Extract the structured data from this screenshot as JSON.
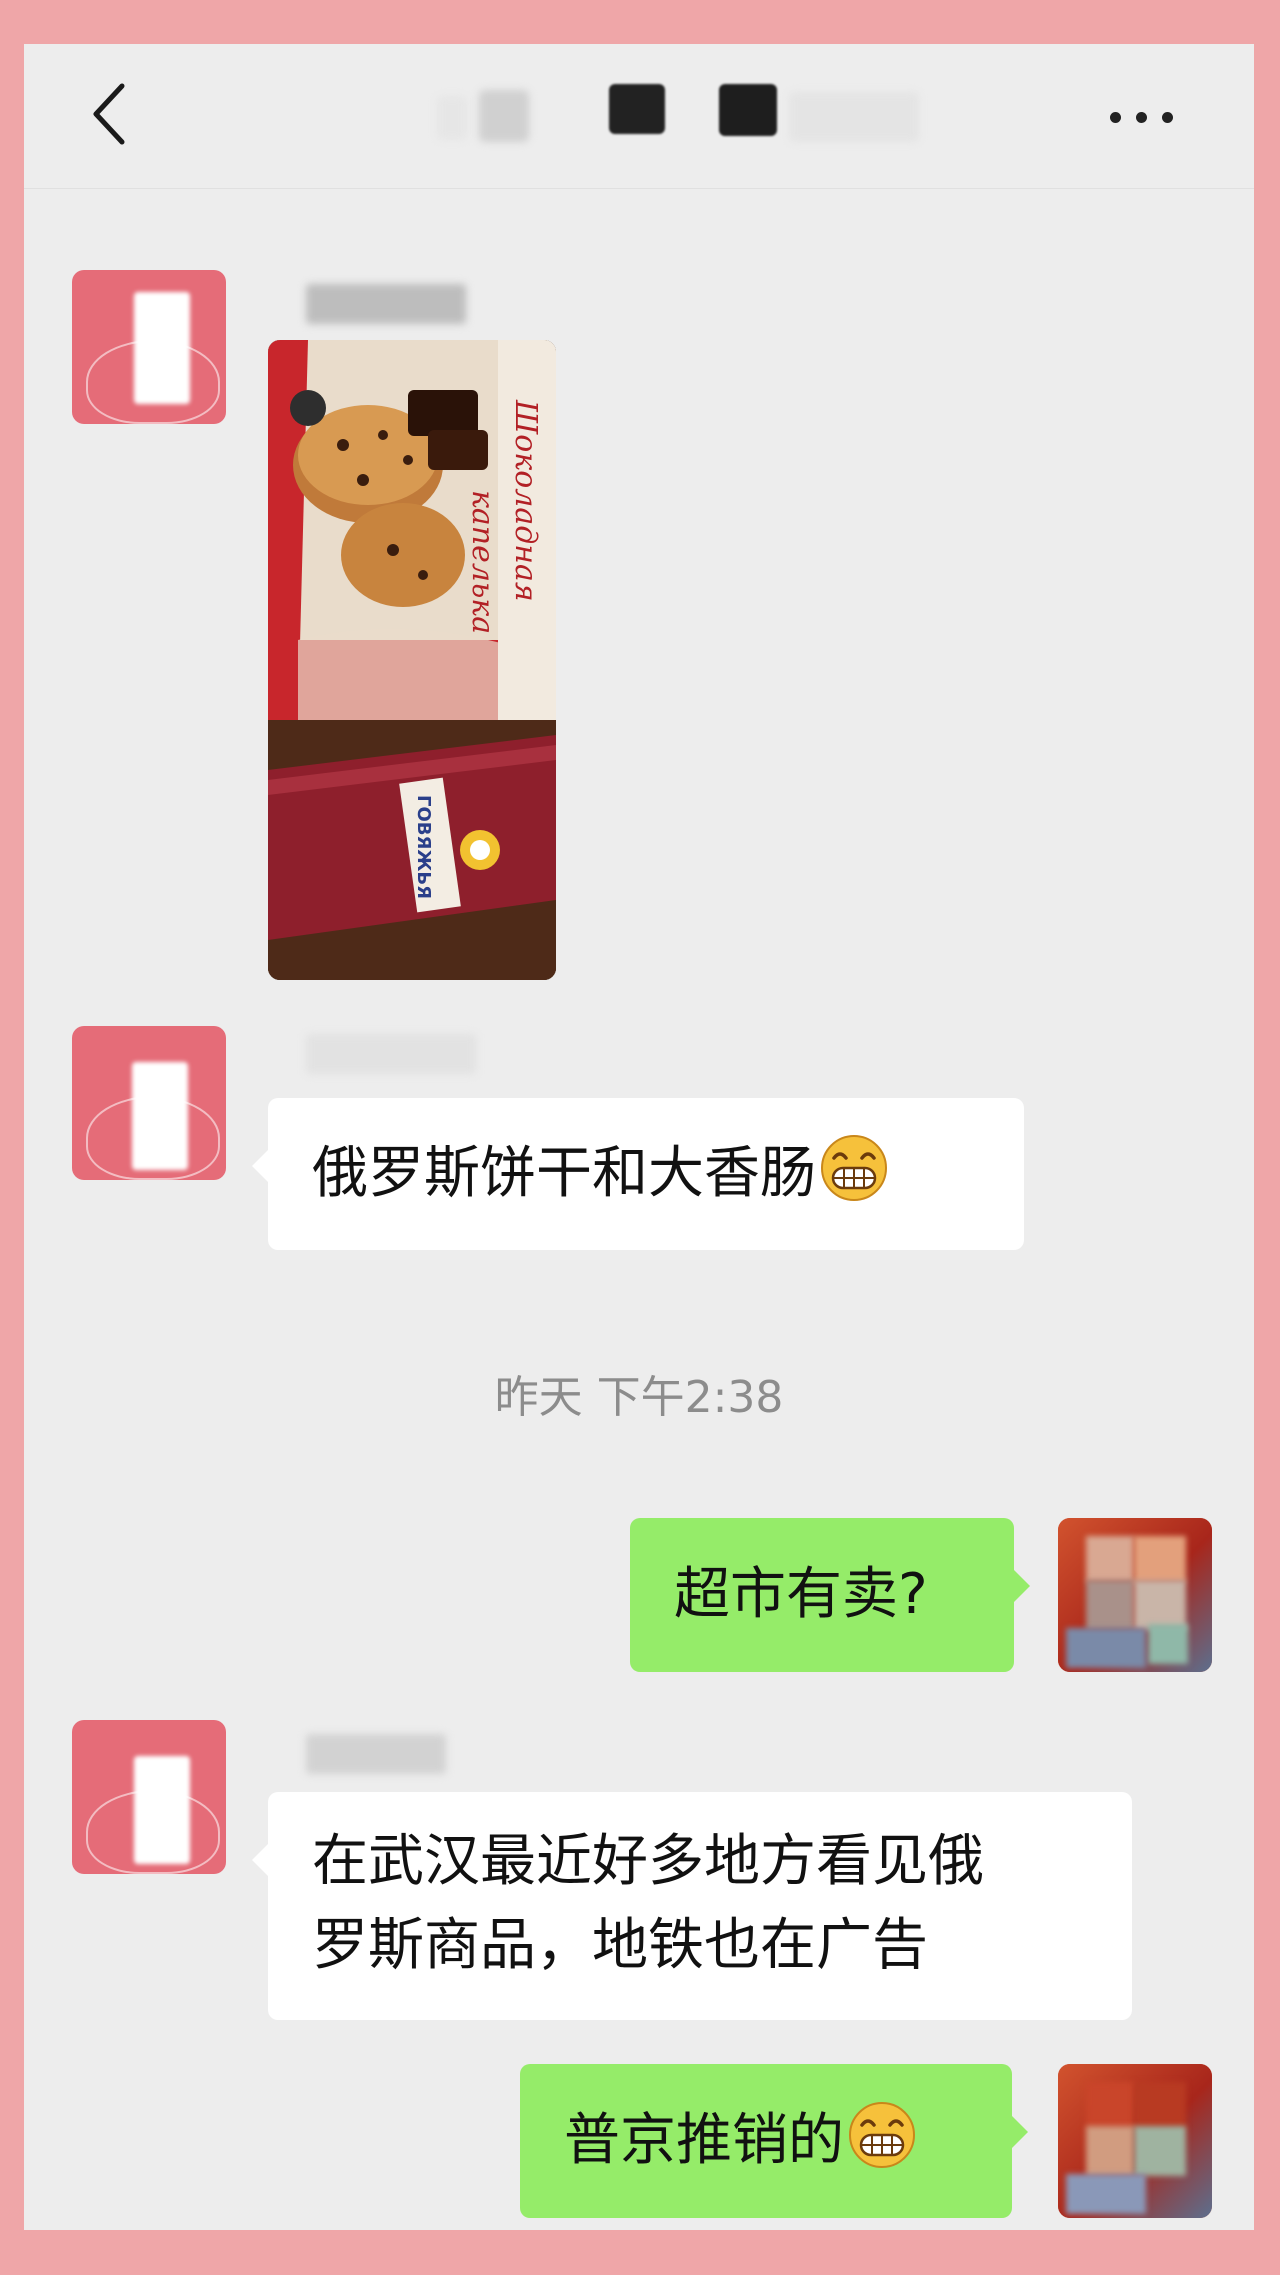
{
  "header": {
    "title": "",
    "back_icon": "chevron-left-icon",
    "more_icon": "more-horizontal-icon"
  },
  "messages": [
    {
      "sender": "other",
      "type": "image",
      "image_text": "ГОВЯЖЬЯ"
    },
    {
      "sender": "other",
      "type": "text",
      "text": "俄罗斯饼干和大香肠",
      "emoji": "grinning-face-icon"
    },
    {
      "sender": "self",
      "type": "text",
      "text": "超市有卖?"
    },
    {
      "sender": "other",
      "type": "text",
      "text": "在武汉最近好多地方看见俄罗斯商品，地铁也在广告",
      "lines": [
        "在武汉最近好多地方看见俄",
        "罗斯商品，地铁也在广告"
      ]
    },
    {
      "sender": "self",
      "type": "text",
      "text": "普京推销的",
      "emoji": "grinning-face-icon"
    }
  ],
  "timestamp": "昨天 下午2:38",
  "colors": {
    "frame": "#efa6a8",
    "chat_bg": "#ededed",
    "bubble_in": "#ffffff",
    "bubble_out": "#95ec69",
    "timestamp": "#8c8c8c"
  }
}
